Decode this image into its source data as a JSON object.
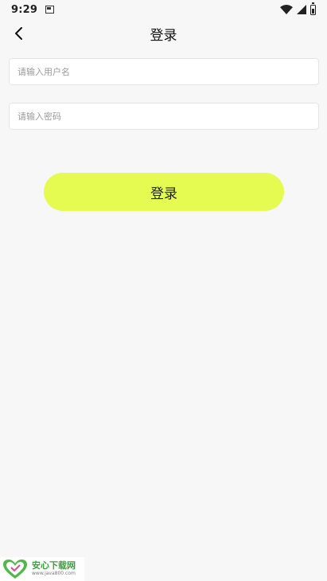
{
  "status_bar": {
    "time": "9:29",
    "icons": [
      "notification-icon",
      "wifi-icon",
      "cell-signal-icon",
      "battery-icon"
    ]
  },
  "header": {
    "title": "登录",
    "back_icon": "chevron-left-icon"
  },
  "form": {
    "username": {
      "placeholder": "请输入用户名",
      "value": ""
    },
    "password": {
      "placeholder": "请输入密码",
      "value": ""
    },
    "submit_label": "登录"
  },
  "colors": {
    "background": "#f7f7f7",
    "button": "#e5fb52",
    "input_border": "#e4e4e4"
  },
  "watermark": {
    "title": "安心下载网",
    "url": "www.java800.com"
  }
}
